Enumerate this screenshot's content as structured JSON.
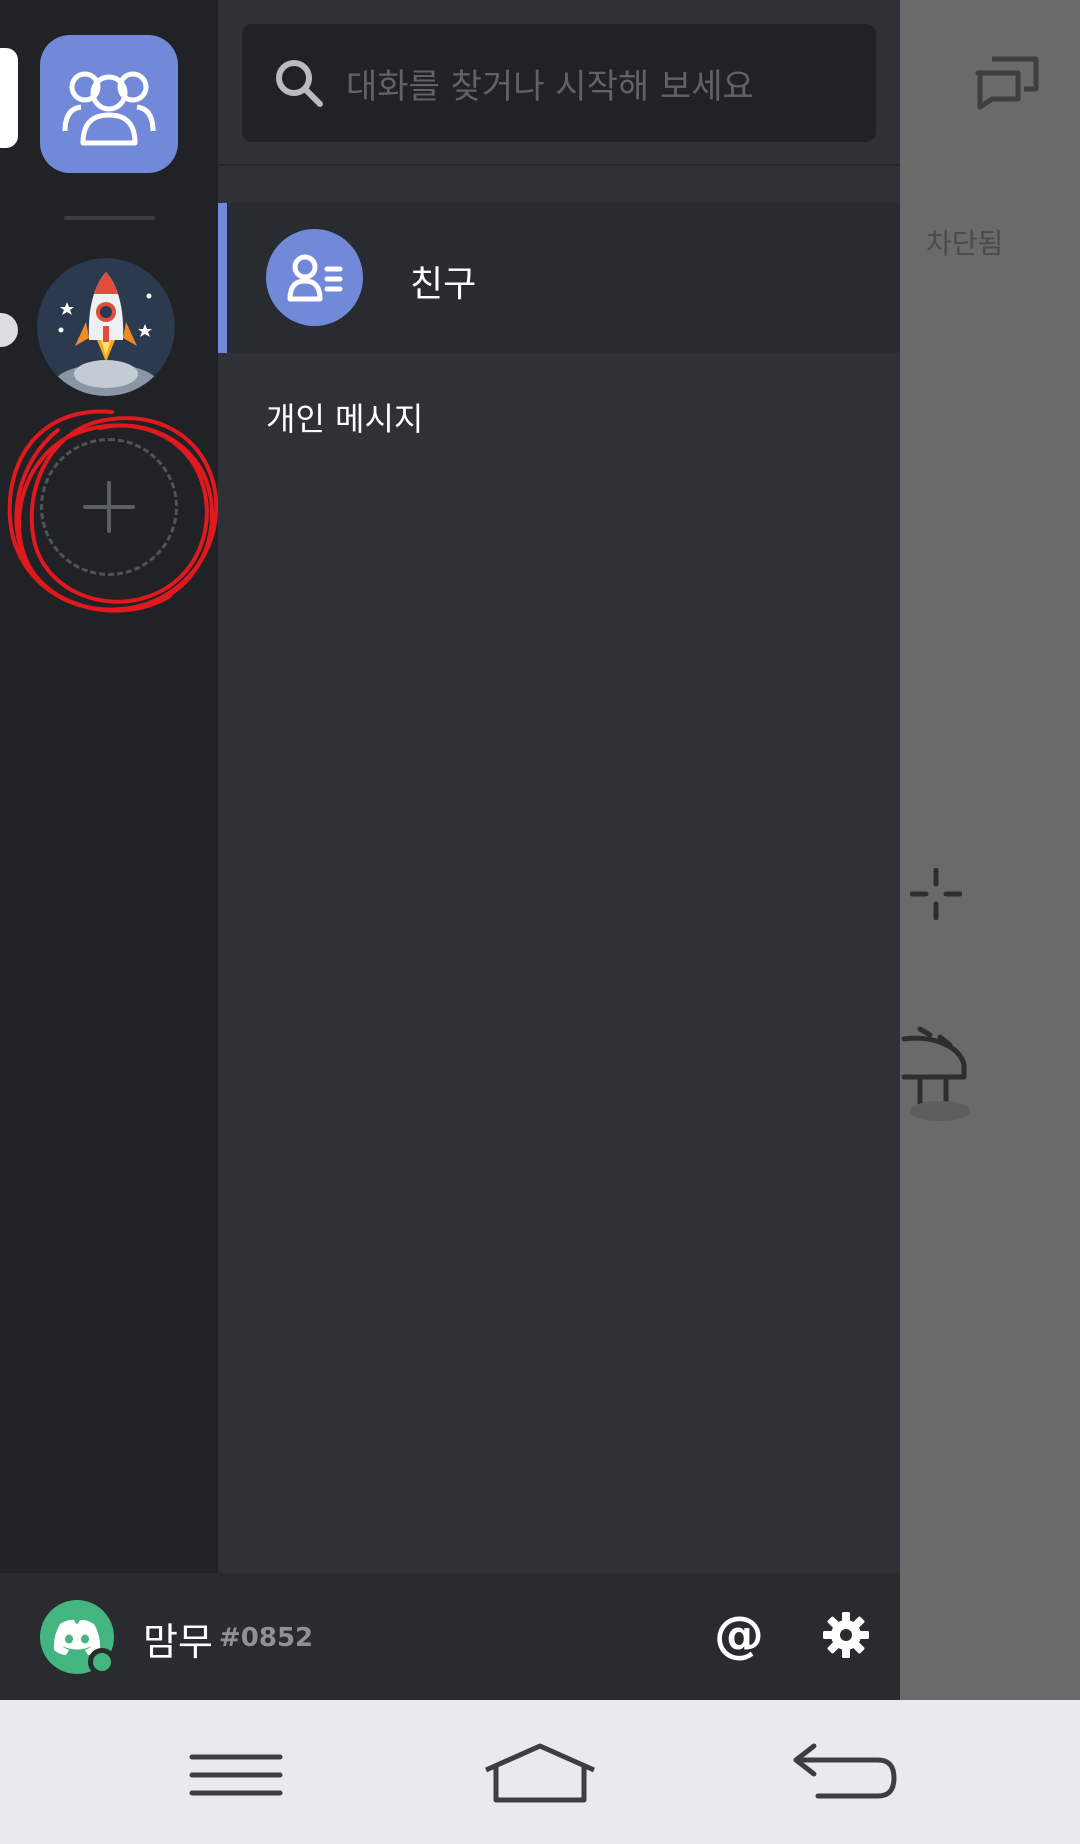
{
  "search": {
    "placeholder": "대화를 찾거나 시작해 보세요"
  },
  "channels": {
    "friends_label": "친구",
    "dm_section_header": "개인 메시지"
  },
  "overlay": {
    "blocked_label": "차단됨"
  },
  "user": {
    "name": "맘무",
    "discriminator": "#0852",
    "mentions_symbol": "@",
    "status": "online"
  },
  "colors": {
    "blurple": "#7289da",
    "online_green": "#43b581",
    "annotation_red": "#e0191e"
  },
  "icons": {
    "home": "friends-group-icon",
    "add_server": "plus-icon",
    "search": "search-icon",
    "friends": "friends-list-icon",
    "new_dm": "new-group-dm-icon",
    "settings": "gear-icon",
    "nav_menu": "menu-icon",
    "nav_home": "home-icon",
    "nav_back": "back-icon"
  }
}
